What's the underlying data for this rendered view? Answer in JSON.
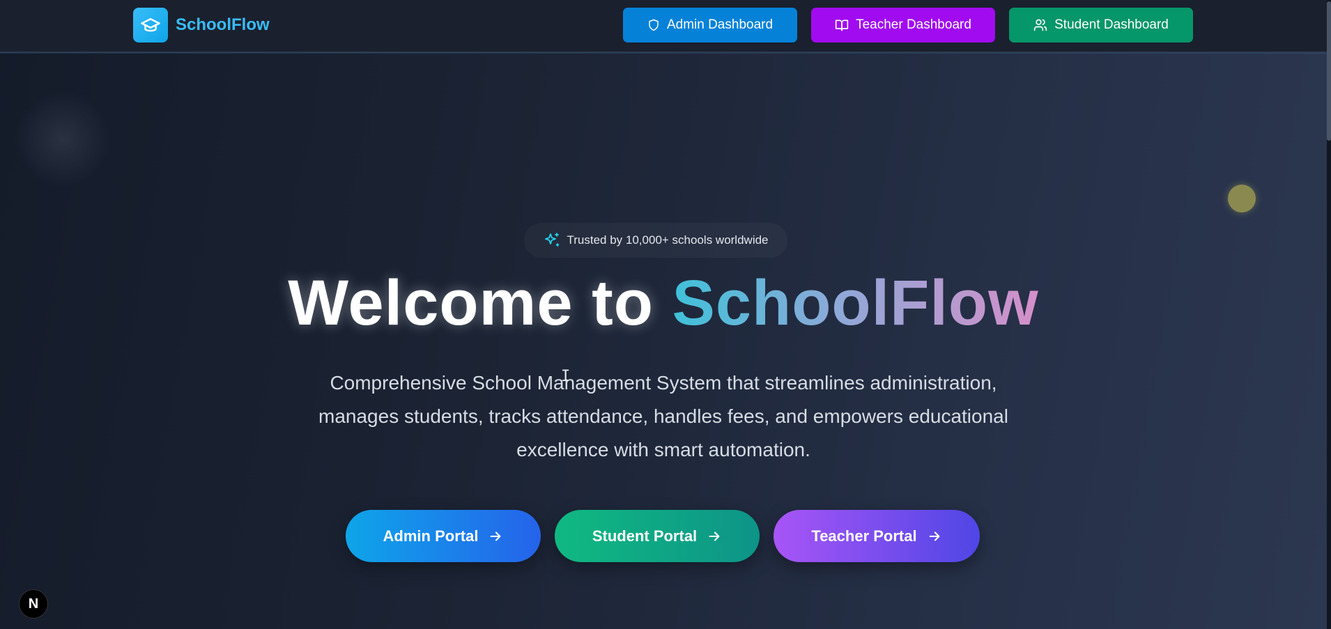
{
  "brand": {
    "name": "SchoolFlow",
    "logo_icon": "graduation-cap-icon"
  },
  "nav": [
    {
      "label": "Admin Dashboard",
      "icon": "shield-icon",
      "color": "#0582d8"
    },
    {
      "label": "Teacher Dashboard",
      "icon": "book-open-icon",
      "color": "#a10bf0"
    },
    {
      "label": "Student Dashboard",
      "icon": "users-icon",
      "color": "#059669"
    }
  ],
  "hero": {
    "badge": "Trusted by 10,000+ schools worldwide",
    "badge_icon": "sparkles-icon",
    "title_prefix": "Welcome to",
    "title_highlight": "SchoolFlow",
    "description": "Comprehensive School Management System that streamlines administration, manages students, tracks attendance, handles fees, and empowers educational excellence with smart automation."
  },
  "cta": [
    {
      "label": "Admin Portal",
      "icon": "arrow-right-icon"
    },
    {
      "label": "Student Portal",
      "icon": "arrow-right-icon"
    },
    {
      "label": "Teacher Portal",
      "icon": "arrow-right-icon"
    }
  ],
  "dev_badge": {
    "label": "N"
  },
  "colors": {
    "brand_accent": "#38bdf8",
    "background": "#1c2435"
  }
}
